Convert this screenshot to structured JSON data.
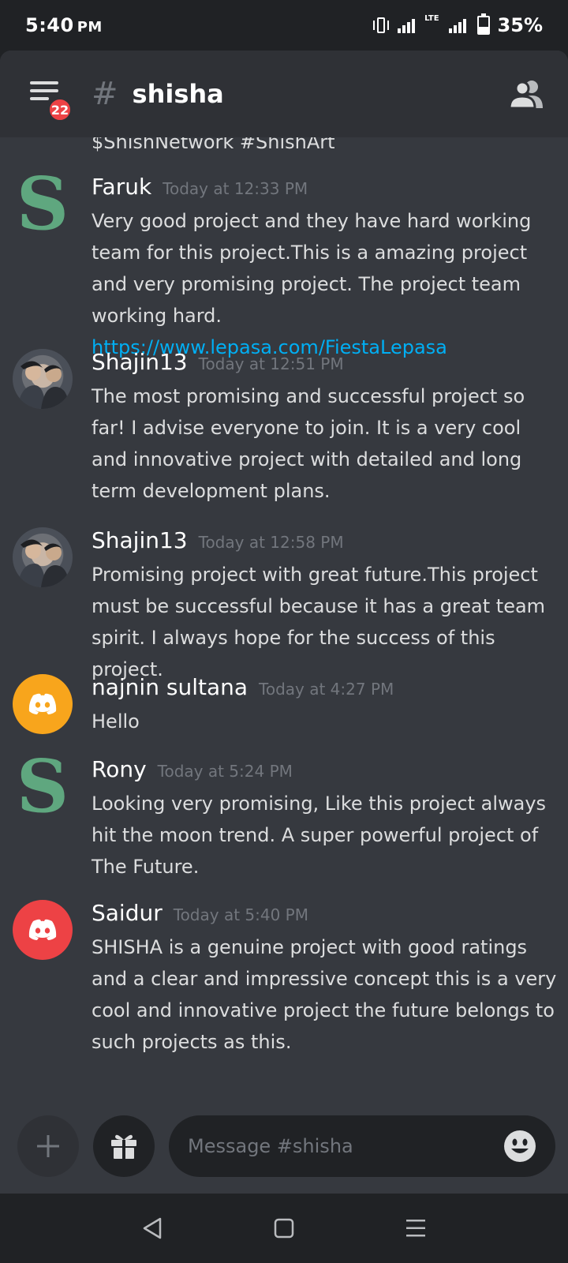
{
  "status_bar": {
    "time": "5:40",
    "ampm": "PM",
    "network": "LTE",
    "battery": "35%",
    "battery_level": 0.35
  },
  "header": {
    "menu_icon": "hamburger-menu-icon",
    "badge_count": "22",
    "hash_symbol": "#",
    "channel_name": "shisha",
    "members_icon": "members-icon"
  },
  "messages": {
    "partial_previous_line": "$ShishNetwork #ShishArt",
    "items": [
      {
        "username": "Faruk",
        "timestamp": "Today at 12:33 PM",
        "text": "Very good project and they have hard working team for this project.This is a amazing project and very promising project. The project team working hard. ",
        "link": "https://www.lepasa.com/FiestaLepasa",
        "avatar": "s-logo",
        "avatar_letter": "S"
      },
      {
        "username": "Shajin13",
        "timestamp": "Today at 12:51 PM",
        "text": "The most promising and successful project so far! I advise everyone to join. It is a very cool and innovative project with detailed and long term development plans.",
        "avatar": "photo"
      },
      {
        "username": "Shajin13",
        "timestamp": "Today at 12:58 PM",
        "text": "Promising project with great future.This project must be successful because it has a great team spirit. I always hope for the success of this project.",
        "avatar": "photo"
      },
      {
        "username": "najnin sultana",
        "timestamp": "Today at 4:27 PM",
        "text": "Hello",
        "avatar": "discord-orange",
        "avatar_color": "#f8a51c"
      },
      {
        "username": "Rony",
        "timestamp": "Today at 5:24 PM",
        "text": "Looking very promising, Like this project always hit the moon trend. A super powerful project of The Future.",
        "avatar": "s-logo",
        "avatar_letter": "S"
      },
      {
        "username": "Saidur",
        "timestamp": "Today at 5:40 PM",
        "text": "SHISHA is a genuine project with good ratings and a clear and impressive concept this is a very cool and innovative project the future belongs to such projects as this.",
        "avatar": "discord-red",
        "avatar_color": "#ed4245"
      }
    ]
  },
  "composer": {
    "add_icon": "plus-icon",
    "gift_icon": "gift-icon",
    "placeholder": "Message #shisha",
    "emoji_icon": "smiley-emoji-icon"
  },
  "nav": {
    "back_icon": "back-triangle-icon",
    "home_icon": "home-square-icon",
    "recents_icon": "recents-menu-icon"
  },
  "colors": {
    "background": "#36393f",
    "header": "#2f3136",
    "link": "#00aff4",
    "badge": "#ed4245",
    "timestamp": "#72767d"
  }
}
